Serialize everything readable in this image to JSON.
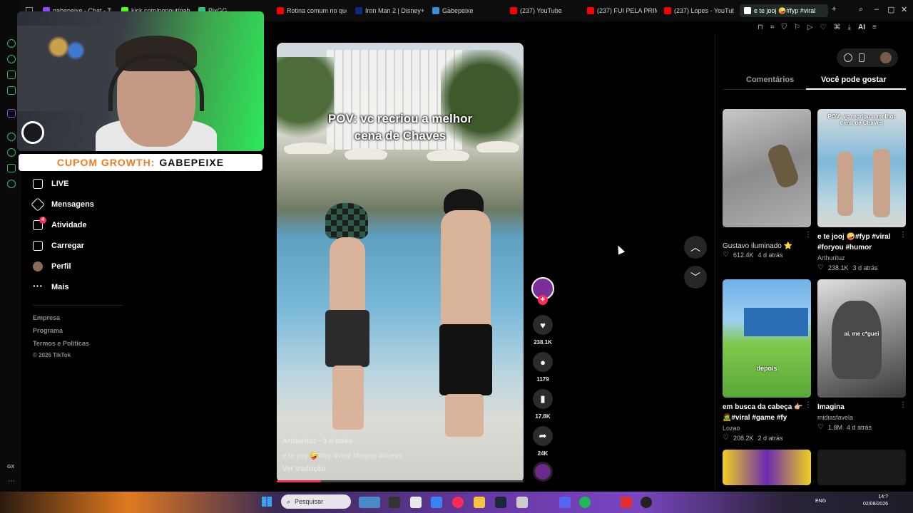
{
  "browser": {
    "tabs": [
      {
        "title": "gabepeixe - Chat - Tw",
        "icon": "twitch-icon",
        "color": "#9146ff"
      },
      {
        "title": "kick.com/popout/gab",
        "icon": "kick-icon",
        "color": "#53fc18"
      },
      {
        "title": "PixGG",
        "icon": "pixgg-icon",
        "color": "#2ec27e"
      },
      {
        "title": "Rotina comum no que",
        "icon": "youtube-icon",
        "color": "#ff0000"
      },
      {
        "title": "Iron Man 2 | Disney+",
        "icon": "disney-icon",
        "color": "#0d2b7a"
      },
      {
        "title": "Gabepeixe",
        "icon": "site-icon",
        "color": "#3a8ed8"
      },
      {
        "title": "(237) YouTube",
        "icon": "youtube-icon",
        "color": "#ff0000"
      },
      {
        "title": "(237) FUI PELA PRIME",
        "icon": "youtube-icon",
        "color": "#ff0000"
      },
      {
        "title": "(237) Lopes - YouTub",
        "icon": "youtube-icon",
        "color": "#ff0000"
      },
      {
        "title": "e te jooj 🤪#fyp #viral",
        "icon": "tiktok-icon",
        "color": "#ffffff",
        "active": true
      }
    ],
    "new_tab": "+",
    "ai_label": "AI",
    "gx_label": "GX"
  },
  "stream_overlay": {
    "coupon_label": "CUPOM GROWTH:",
    "coupon_code": "GABEPEIXE"
  },
  "nav": {
    "items": [
      {
        "label": "LIVE",
        "icon": "live-icon"
      },
      {
        "label": "Mensagens",
        "icon": "messages-icon"
      },
      {
        "label": "Atividade",
        "icon": "activity-icon",
        "badge": "4"
      },
      {
        "label": "Carregar",
        "icon": "upload-icon"
      },
      {
        "label": "Perfil",
        "icon": "profile-avatar"
      },
      {
        "label": "Mais",
        "icon": "more-icon"
      }
    ],
    "footer": [
      "Empresa",
      "Programa",
      "Termos e Políticas",
      "© 2026 TikTok"
    ]
  },
  "video": {
    "caption_line1": "POV: vc recriou a melhor",
    "caption_line2": "cena de Chaves",
    "author": "Arthurituz · 3 d atrás",
    "description": "e te jooj 🤪#fyp #viral #foryou #humor",
    "translate": "Ver tradução",
    "progress": 0.18
  },
  "actions": {
    "likes": "238.1K",
    "comments": "1179",
    "saves": "17.8K",
    "shares": "24K"
  },
  "right_panel": {
    "tabs": [
      "Comentários",
      "Você pode gostar"
    ],
    "active_tab": "Você pode gostar",
    "videos": [
      {
        "title": "Gustavo iluminado ⭐",
        "author": "",
        "likes": "612.4K",
        "age": "4 d atrás",
        "bold": false
      },
      {
        "title": "e te jooj 🤪#fyp #viral #foryou #humor",
        "author": "Arthurituz",
        "likes": "238.1K",
        "age": "3 d atrás",
        "bold": true,
        "overlay": "POV: vc recriou a melhor cena de Chaves"
      },
      {
        "title": "em busca da cabeça 👉🏼 🧟#viral #game #fy",
        "author": "Lozao",
        "likes": "208.2K",
        "age": "2 d atrás",
        "bold": true,
        "overlay": "depois"
      },
      {
        "title": "Imagina",
        "author": "midiasfavela",
        "likes": "1.8M",
        "age": "4 d atrás",
        "bold": true,
        "overlay": "ai, me c*guei"
      }
    ]
  },
  "taskbar": {
    "search_placeholder": "Pesquisar",
    "lang": "ENG",
    "time": "14:?",
    "date": "02/08/2026"
  }
}
